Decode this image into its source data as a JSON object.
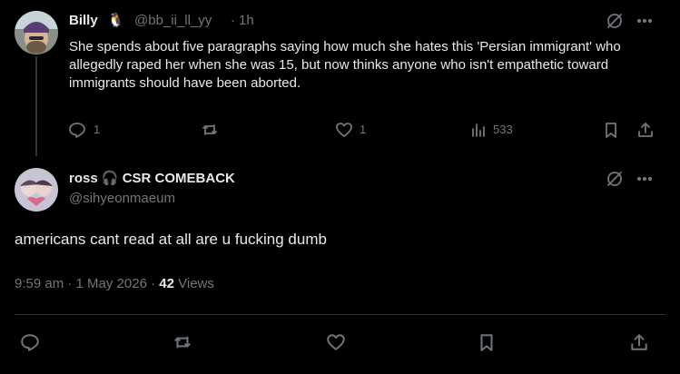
{
  "parent": {
    "name": "Billy",
    "emoji": "🐧",
    "handle": "@bb_ii_ll_yy",
    "dot": "·",
    "time": "1h",
    "text": "She spends about five paragraphs saying how much she hates this 'Persian immigrant' who allegedly raped her when she was 15, but now thinks anyone who isn't empathetic toward immigrants should have been aborted.",
    "stats": {
      "replies": "1",
      "likes": "1",
      "views": "533"
    }
  },
  "reply": {
    "name": "ross 🎧 CSR COMEBACK",
    "handle": "@sihyeonmaeum",
    "text": "americans cant read at all are u fucking dumb",
    "timestamp": "9:59 am · 1 May 2026",
    "dot": "·",
    "views_count": "42",
    "views_label": "Views"
  },
  "icons": {
    "grok": "grok-icon",
    "more": "more-icon",
    "reply": "reply-icon",
    "retweet": "retweet-icon",
    "like": "heart-icon",
    "views": "views-icon",
    "bookmark": "bookmark-icon",
    "share": "share-icon"
  },
  "colors": {
    "background": "#000000",
    "text": "#e7e9ea",
    "muted": "#71767b",
    "divider": "#2f3336"
  }
}
